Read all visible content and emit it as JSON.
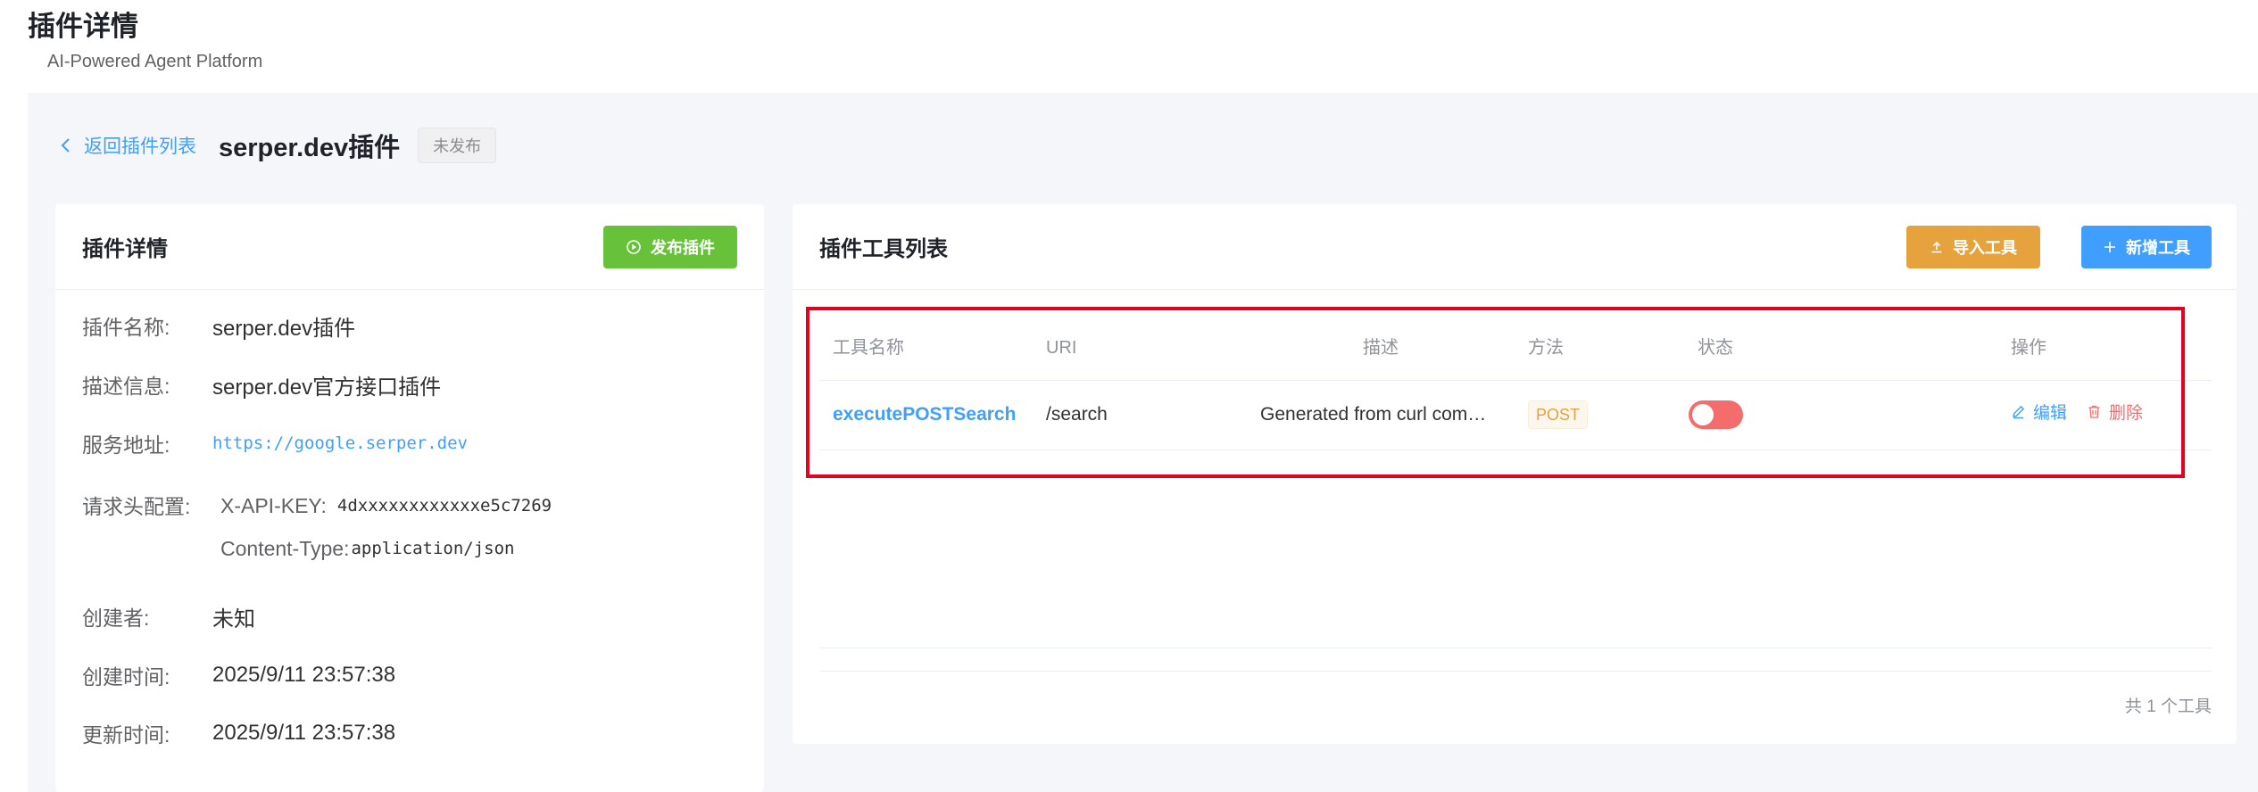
{
  "page": {
    "title": "插件详情",
    "subtitle": "AI-Powered Agent Platform"
  },
  "topbar": {
    "back_label": "返回插件列表",
    "plugin_name": "serper.dev插件",
    "status": "未发布"
  },
  "detail_card": {
    "title": "插件详情",
    "publish_button": "发布插件",
    "rows": {
      "name_label": "插件名称:",
      "name_value": "serper.dev插件",
      "desc_label": "描述信息:",
      "desc_value": "serper.dev官方接口插件",
      "url_label": "服务地址:",
      "url_value": "https://google.serper.dev",
      "headers_label": "请求头配置:",
      "headers": [
        {
          "key": "X-API-KEY:",
          "value": "4dxxxxxxxxxxxxe5c7269"
        },
        {
          "key": "Content-Type:",
          "value": "application/json"
        }
      ],
      "creator_label": "创建者:",
      "creator_value": "未知",
      "created_label": "创建时间:",
      "created_value": "2025/9/11 23:57:38",
      "updated_label": "更新时间:",
      "updated_value": "2025/9/11 23:57:38"
    }
  },
  "tools_card": {
    "title": "插件工具列表",
    "import_button": "导入工具",
    "add_button": "新增工具",
    "columns": [
      "工具名称",
      "URI",
      "描述",
      "方法",
      "状态",
      "操作"
    ],
    "rows": [
      {
        "name": "executePOSTSearch",
        "uri": "/search",
        "description": "Generated from curl com…",
        "method": "POST",
        "enabled": false,
        "edit_label": "编辑",
        "delete_label": "删除"
      }
    ],
    "footer": "共 1 个工具"
  },
  "colors": {
    "accent": "#409eff",
    "success": "#67c23a",
    "warning": "#e6a23c",
    "danger": "#f56c6c",
    "highlight_frame": "#e8001c"
  }
}
